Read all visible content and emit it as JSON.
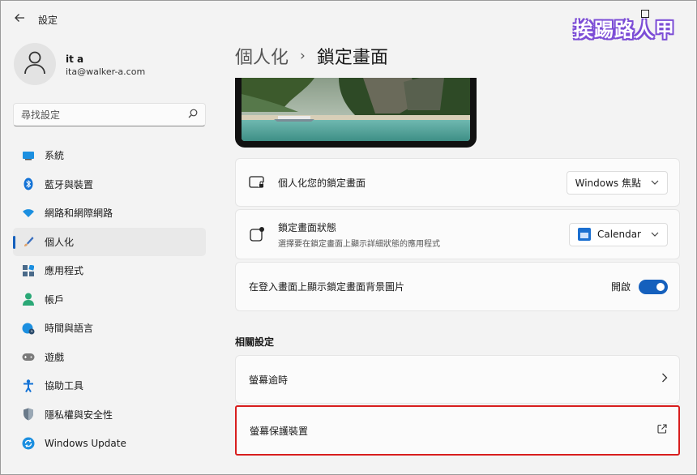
{
  "window": {
    "back_icon": "arrow-left-icon",
    "title": "設定",
    "watermark": "挨踢路人甲"
  },
  "profile": {
    "name": "it a",
    "email": "ita@walker-a.com",
    "avatar_icon": "person-icon"
  },
  "search": {
    "placeholder": "尋找設定",
    "icon": "search-icon"
  },
  "nav": {
    "items": [
      {
        "label": "系統",
        "icon": "monitor-icon",
        "color": "#1b8fe0"
      },
      {
        "label": "藍牙與裝置",
        "icon": "bluetooth-icon",
        "color": "#1272d6"
      },
      {
        "label": "網路和網際網路",
        "icon": "wifi-icon",
        "color": "#1b8fe0"
      },
      {
        "label": "個人化",
        "icon": "brush-icon",
        "color": "#e0a36b",
        "active": true
      },
      {
        "label": "應用程式",
        "icon": "apps-icon",
        "color": "#4a6a8a"
      },
      {
        "label": "帳戶",
        "icon": "account-icon",
        "color": "#2aa876"
      },
      {
        "label": "時間與語言",
        "icon": "globe-clock-icon",
        "color": "#1b8fe0"
      },
      {
        "label": "遊戲",
        "icon": "gamepad-icon",
        "color": "#7a7a7a"
      },
      {
        "label": "協助工具",
        "icon": "accessibility-icon",
        "color": "#1272d6"
      },
      {
        "label": "隱私權與安全性",
        "icon": "shield-icon",
        "color": "#6a7a8a"
      },
      {
        "label": "Windows Update",
        "icon": "update-icon",
        "color": "#1b8fe0"
      }
    ]
  },
  "main": {
    "breadcrumb_parent": "個人化",
    "breadcrumb_sep": "›",
    "breadcrumb_current": "鎖定畫面",
    "personalize": {
      "title": "個人化您的鎖定畫面",
      "icon": "lock-screen-icon",
      "value": "Windows 焦點"
    },
    "status": {
      "title": "鎖定畫面狀態",
      "subtitle": "選擇要在鎖定畫面上顯示詳細狀態的應用程式",
      "icon": "status-icon",
      "value": "Calendar"
    },
    "signin_bg": {
      "title": "在登入畫面上顯示鎖定畫面背景圖片",
      "toggle_label": "開啟",
      "toggle_on": true,
      "accent": "#1560bd"
    },
    "related_title": "相關設定",
    "screen_timeout": {
      "title": "螢幕逾時",
      "icon": "chevron-right-icon"
    },
    "screensaver": {
      "title": "螢幕保護裝置",
      "icon": "external-link-icon",
      "highlight_color": "#d81e1e"
    }
  }
}
